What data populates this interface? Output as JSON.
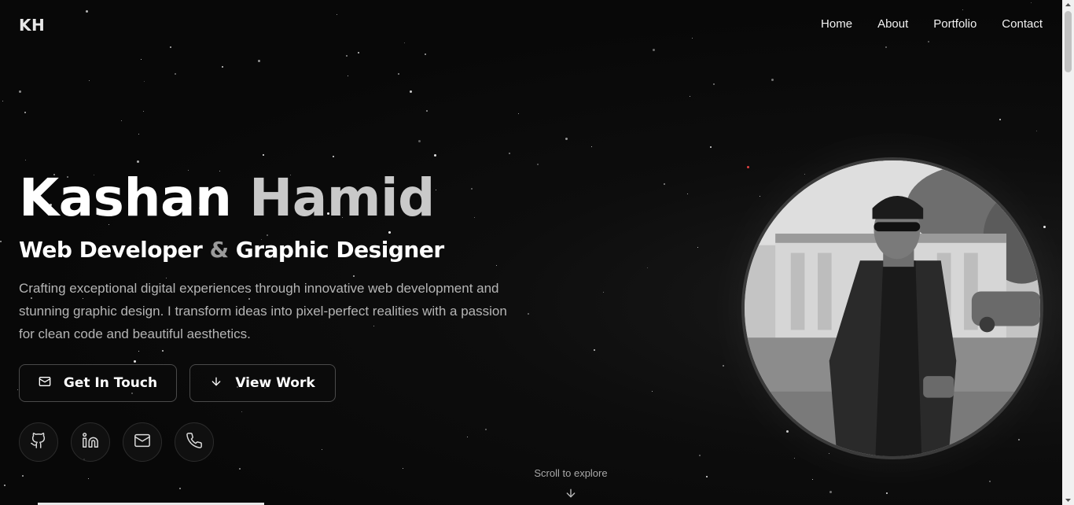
{
  "header": {
    "logo": "KH",
    "nav": [
      "Home",
      "About",
      "Portfolio",
      "Contact"
    ]
  },
  "hero": {
    "first_name": "Kashan",
    "last_name": "Hamid",
    "role_part1": "Web Developer",
    "role_amp": "&",
    "role_part2": "Graphic Designer",
    "description": "Crafting exceptional digital experiences through innovative web development and stunning graphic design. I transform ideas into pixel-perfect realities with a passion for clean code and beautiful aesthetics."
  },
  "buttons": {
    "get_in_touch": "Get In Touch",
    "view_work": "View Work"
  },
  "social": [
    "github-icon",
    "linkedin-icon",
    "mail-icon",
    "phone-icon"
  ],
  "scroll_hint": "Scroll to explore",
  "colors": {
    "background": "#0a0a0a",
    "text": "#ffffff",
    "muted": "#b5b5b5",
    "accent_gray": "#c9c9c9"
  }
}
